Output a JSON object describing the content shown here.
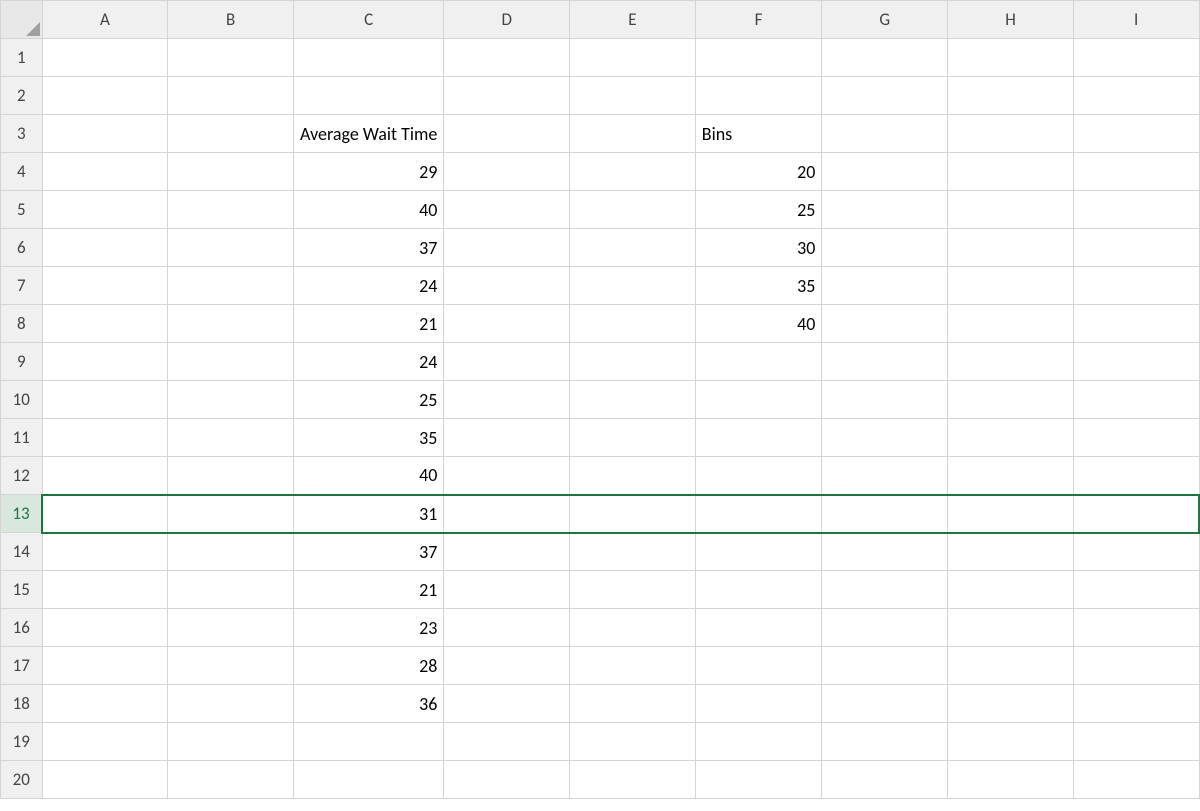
{
  "columns": [
    "A",
    "B",
    "C",
    "D",
    "E",
    "F",
    "G",
    "H",
    "I"
  ],
  "rows": [
    1,
    2,
    3,
    4,
    5,
    6,
    7,
    8,
    9,
    10,
    11,
    12,
    13,
    14,
    15,
    16,
    17,
    18,
    19,
    20
  ],
  "selectedRow": 13,
  "cells": {
    "C3": {
      "value": "Average Wait Time",
      "align": "left"
    },
    "F3": {
      "value": "Bins",
      "align": "left"
    },
    "C4": {
      "value": "29"
    },
    "C5": {
      "value": "40"
    },
    "C6": {
      "value": "37"
    },
    "C7": {
      "value": "24"
    },
    "C8": {
      "value": "21"
    },
    "C9": {
      "value": "24"
    },
    "C10": {
      "value": "25"
    },
    "C11": {
      "value": "35"
    },
    "C12": {
      "value": "40"
    },
    "C13": {
      "value": "31"
    },
    "C14": {
      "value": "37"
    },
    "C15": {
      "value": "21"
    },
    "C16": {
      "value": "23"
    },
    "C17": {
      "value": "28"
    },
    "C18": {
      "value": "36"
    },
    "F4": {
      "value": "20"
    },
    "F5": {
      "value": "25"
    },
    "F6": {
      "value": "30"
    },
    "F7": {
      "value": "35"
    },
    "F8": {
      "value": "40"
    }
  }
}
